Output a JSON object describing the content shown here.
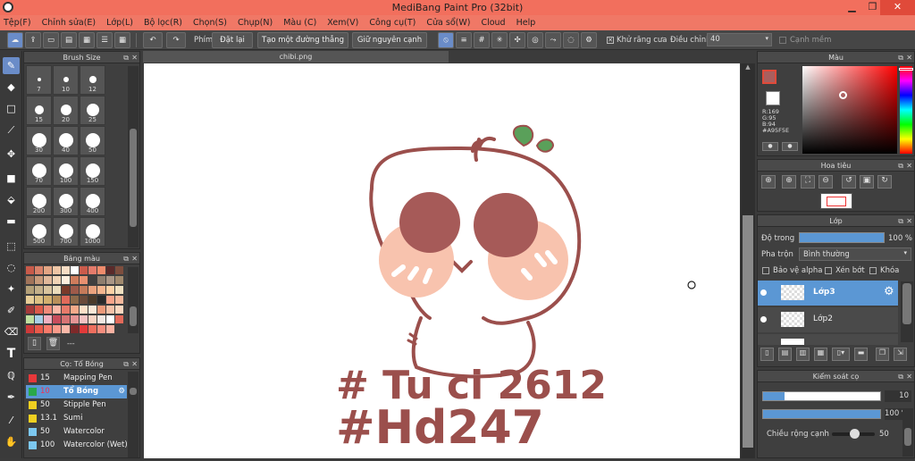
{
  "app": {
    "title": "MediBang Paint Pro (32bit)",
    "win_buttons": [
      "▁",
      "❐",
      "✕"
    ]
  },
  "menu": [
    "Tệp(F)",
    "Chỉnh sửa(E)",
    "Lớp(L)",
    "Bộ lọc(R)",
    "Chọn(S)",
    "Chụp(N)",
    "Màu (C)",
    "Xem(V)",
    "Công cụ(T)",
    "Cửa sổ(W)",
    "Cloud",
    "Help"
  ],
  "toolbar": {
    "phim_label": "Phím",
    "reset": "Đặt lại",
    "line": "Tạo một đường thẳng",
    "keep_edge": "Giữ nguyên cạnh",
    "antialias": "Khử răng cưa",
    "adjust_label": "Điều chỉnh",
    "adjust_value": "40",
    "sharp": "Cạnh mềm"
  },
  "brush_size": {
    "title": "Brush Size",
    "sizes": [
      "7",
      "10",
      "12",
      "15",
      "20",
      "25",
      "30",
      "40",
      "50",
      "70",
      "100",
      "150",
      "200",
      "300",
      "400",
      "500",
      "700",
      "1000"
    ]
  },
  "palette": {
    "title": "Bảng màu",
    "footer": "---",
    "colors": [
      "#c85a4a",
      "#d9826a",
      "#e3a584",
      "#efc6a6",
      "#f6dcc4",
      "#ffffff",
      "#cb5b4b",
      "#e47b6b",
      "#f08c6c",
      "#5a2a2a",
      "#7e4e3e",
      "#a0735a",
      "#c79a7a",
      "#e0b89a",
      "#f1d4b6",
      "#fdeede",
      "#cf7c5c",
      "#e89070",
      "#3f3f3f",
      "#8e7e6e",
      "#a99686",
      "#a18a6e",
      "#b3a078",
      "#c3b08a",
      "#d8c49e",
      "#eadcbc",
      "#7a3a2a",
      "#9e5a4a",
      "#c47a5a",
      "#e9a27e",
      "#f4b58e",
      "#fcd1a6",
      "#f0e0c0",
      "#e8ce98",
      "#dcc084",
      "#d2af6e",
      "#b8905a",
      "#e06a5a",
      "#8e6a4a",
      "#6a4a3a",
      "#4a3a2a",
      "#2a2a2a",
      "#f8a48a",
      "#f6b89c",
      "#a43a3a",
      "#dc5a4a",
      "#f08a7a",
      "#fbb8a8",
      "#e87a6a",
      "#f4aa8a",
      "#fde0c8",
      "#fae8d8",
      "#ec9a7a",
      "#f6c2a8",
      "#fcd8c0",
      "#c0e0a0",
      "#a8d0e8",
      "#f0b0c0",
      "#c84c5c",
      "#d87474",
      "#e59494",
      "#f4c2c2",
      "#f8d4c4",
      "#f2e8e2",
      "#ffffff",
      "#e46a5a",
      "#cc3a3a",
      "#e85a4a",
      "#f87a6a",
      "#fa9a8a",
      "#fcb8a8",
      "#7e2a2a",
      "#e23a3a",
      "#ee6e5e",
      "#f58e7e",
      "#fbb2a2"
    ]
  },
  "brushes": {
    "title": "Cọ: Tổ Bóng",
    "items": [
      {
        "size": "15",
        "name": "Mapping Pen",
        "color": "#e8383a"
      },
      {
        "size": "10",
        "name": "Tổ Bóng",
        "color": "#2aa84a"
      },
      {
        "size": "50",
        "name": "Stipple Pen",
        "color": "#f0d020"
      },
      {
        "size": "13.1",
        "name": "Sumi",
        "color": "#f0d020"
      },
      {
        "size": "50",
        "name": "Watercolor",
        "color": "#7cc8f0"
      },
      {
        "size": "100",
        "name": "Watercolor (Wet)",
        "color": "#7cc8f0"
      }
    ]
  },
  "document": {
    "tab": "chibi.png"
  },
  "color_panel": {
    "title": "Màu",
    "r": "R:169",
    "g": "G:95",
    "b": "B:94",
    "hex": "#A95F5E"
  },
  "navigator": {
    "title": "Hoa tiêu"
  },
  "layers": {
    "title": "Lớp",
    "opacity_label": "Độ trong",
    "opacity_value": "100 %",
    "blend_label": "Pha trộn",
    "blend_value": "Bình thường",
    "protect_alpha": "Bảo vệ alpha",
    "clipping": "Xén bớt",
    "lock": "Khóa",
    "items": [
      {
        "name": "Lớp3"
      },
      {
        "name": "Lớp2"
      }
    ]
  },
  "brush_control": {
    "title": "Kiểm soát cọ",
    "size_value": "10",
    "opacity_value": "100 %",
    "width_label": "Chiều rộng cạnh",
    "width_value": "50"
  },
  "canvas_text": {
    "line1": "# Tu ci 2612",
    "line2": "#Hd247"
  }
}
